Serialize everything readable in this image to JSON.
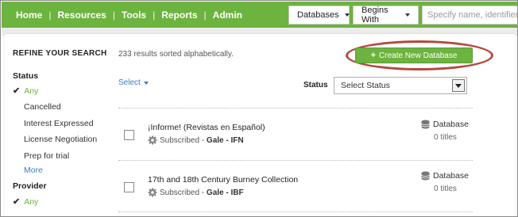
{
  "nav": {
    "links": [
      "Home",
      "Resources",
      "Tools",
      "Reports",
      "Admin"
    ],
    "databases_dropdown": "Databases",
    "begins_with_dropdown": "Begins With",
    "search_placeholder": "Specify name, identifier, etc."
  },
  "sidebar": {
    "title": "REFINE YOUR SEARCH",
    "status": {
      "heading": "Status",
      "selected": "Any",
      "items": [
        "Cancelled",
        "Interest Expressed",
        "License Negotiation",
        "Prep for trial"
      ],
      "more": "More"
    },
    "provider": {
      "heading": "Provider",
      "selected": "Any"
    }
  },
  "main": {
    "results_text": "233 results sorted alphabetically.",
    "create_button": "Create New Database",
    "select_link": "Select",
    "status_filter_label": "Status",
    "status_filter_value": "Select Status",
    "rows": [
      {
        "title": "¡Informe! (Revistas en Español)",
        "status": "Subscribed",
        "provider_code": "Gale - IFN",
        "type": "Database",
        "titles": "0 titles"
      },
      {
        "title": "17th and 18th Century Burney Collection",
        "status": "Subscribed",
        "provider_code": "Gale - IBF",
        "type": "Database",
        "titles": "0 titles"
      }
    ]
  },
  "colors": {
    "brand_green": "#6db33f",
    "link_blue": "#3b7bbf",
    "highlight_red": "#b5473a"
  },
  "icons": [
    "gear-icon",
    "database-icon",
    "checkmark-icon",
    "plus-icon",
    "caret-down-icon"
  ]
}
